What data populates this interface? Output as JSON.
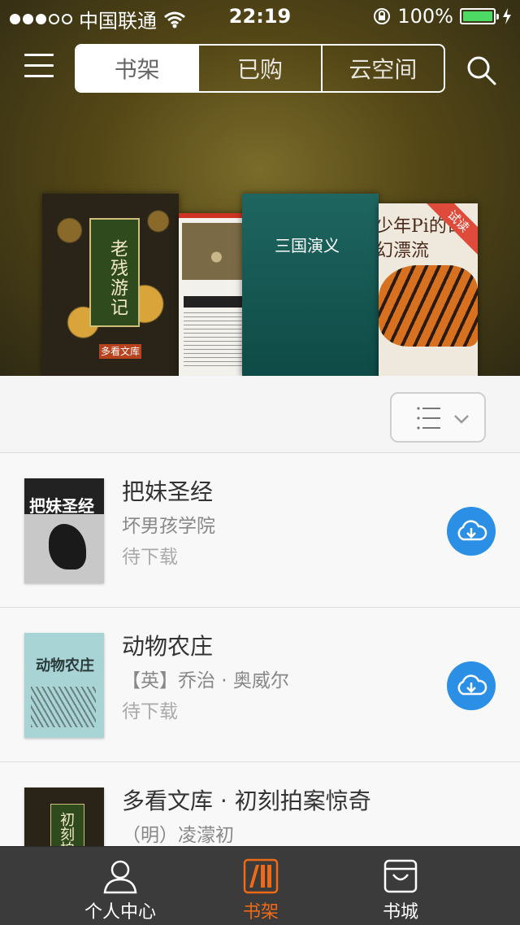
{
  "status_bar": {
    "carrier": "中国联通",
    "time": "22:19",
    "battery": "100%",
    "signal_bars_filled": 3,
    "signal_bars_total": 5
  },
  "header": {
    "tabs": [
      {
        "label": "书架",
        "active": true
      },
      {
        "label": "已购",
        "active": false
      },
      {
        "label": "云空间",
        "active": false
      }
    ]
  },
  "featured_covers": [
    {
      "title": "老残游记",
      "series": "多看文库"
    },
    {
      "title": "",
      "series": ""
    },
    {
      "title": "三国演义",
      "series": ""
    },
    {
      "title": "少年Pi的奇幻漂流",
      "badge": "试读"
    }
  ],
  "books": [
    {
      "title": "把妹圣经",
      "author": "坏男孩学院",
      "status": "待下载",
      "cover_text": "把妹圣经"
    },
    {
      "title": "动物农庄",
      "author": "【英】乔治 · 奥威尔",
      "status": "待下载",
      "cover_text": "动物农庄"
    },
    {
      "title": "多看文库 · 初刻拍案惊奇",
      "author": "（明）凌濛初",
      "status": "",
      "cover_text": "初刻拍案"
    }
  ],
  "tabbar": {
    "items": [
      {
        "label": "个人中心",
        "active": false
      },
      {
        "label": "书架",
        "active": true
      },
      {
        "label": "书城",
        "active": false
      }
    ]
  },
  "colors": {
    "accent": "#ee6a18",
    "download_blue": "#2b8fe6",
    "battery_green": "#4cd964"
  }
}
